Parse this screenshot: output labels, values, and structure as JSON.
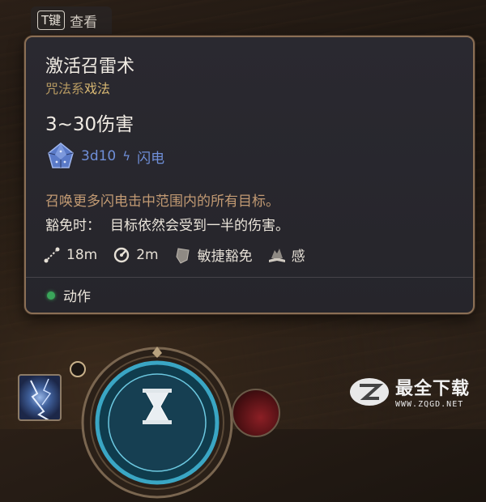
{
  "hint": {
    "key": "T键",
    "label": "查看"
  },
  "spell": {
    "name": "激活召雷术",
    "school": "咒法系",
    "type": "戏法",
    "damage": "3~30伤害",
    "dice": "3d10",
    "damage_type": "闪电",
    "description": "召唤更多闪电击中范围内的所有目标。",
    "save_label": "豁免时：",
    "save_text": "目标依然会受到一半的伤害。",
    "range": "18m",
    "radius": "2m",
    "save_type": "敏捷豁免",
    "extra": "感",
    "action": "动作"
  },
  "colors": {
    "border": "#8b6f55",
    "school": "#b79a62",
    "dice": "#6f8fd8",
    "description": "#c29a73",
    "action_dot": "#3aa55a"
  },
  "icons": [
    "range-icon",
    "radius-icon",
    "shield-icon",
    "book-icon",
    "action-dot-icon",
    "lightning-icon",
    "d10-dice-icon",
    "hourglass-icon",
    "lock-icon"
  ],
  "watermark": {
    "text": "最全下载",
    "url": "WWW.ZQGD.NET"
  }
}
